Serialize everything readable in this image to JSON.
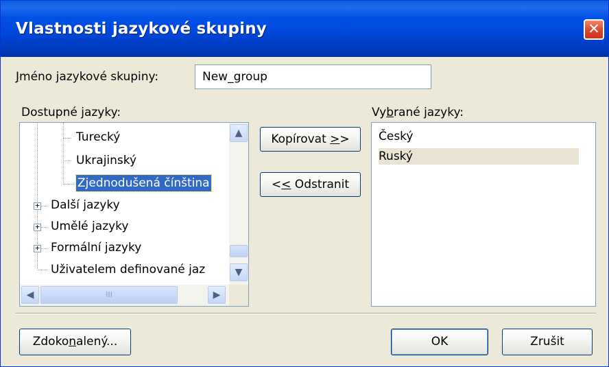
{
  "window": {
    "title": "Vlastnosti jazykové skupiny",
    "close_symbol": "✕"
  },
  "name_field": {
    "label_first": "J",
    "label_rest": "méno jazykové skupiny:",
    "value": "New_group"
  },
  "available": {
    "label_a": "Dostupné ",
    "label_u": "j",
    "label_b": "azyky:",
    "tree_items": [
      "Turecký",
      "Ukrajinský",
      "Zjednodušená čínština",
      "Další jazyky",
      "Umělé jazyky",
      "Formální jazyky",
      "Uživatelem definované jaz"
    ],
    "selected_item": "Zjednodušená čínština",
    "scroll_up": "▲",
    "scroll_down": "▼",
    "scroll_left": "◀",
    "scroll_right": "▶",
    "thumb_grip": "III"
  },
  "buttons": {
    "copy_a": "Kopírovat ",
    "copy_u": ">",
    "copy_b": ">",
    "remove_a": "<",
    "remove_u": "<",
    "remove_b": " Odstranit",
    "advanced_a": "Zdoko",
    "advanced_u": "n",
    "advanced_b": "alený...",
    "ok": "OK",
    "cancel": "Zrušit"
  },
  "selected": {
    "label_a": "Vy",
    "label_u": "b",
    "label_b": "rané jazyky:",
    "items": [
      "Český",
      "Ruský"
    ],
    "highlighted": "Ruský"
  }
}
